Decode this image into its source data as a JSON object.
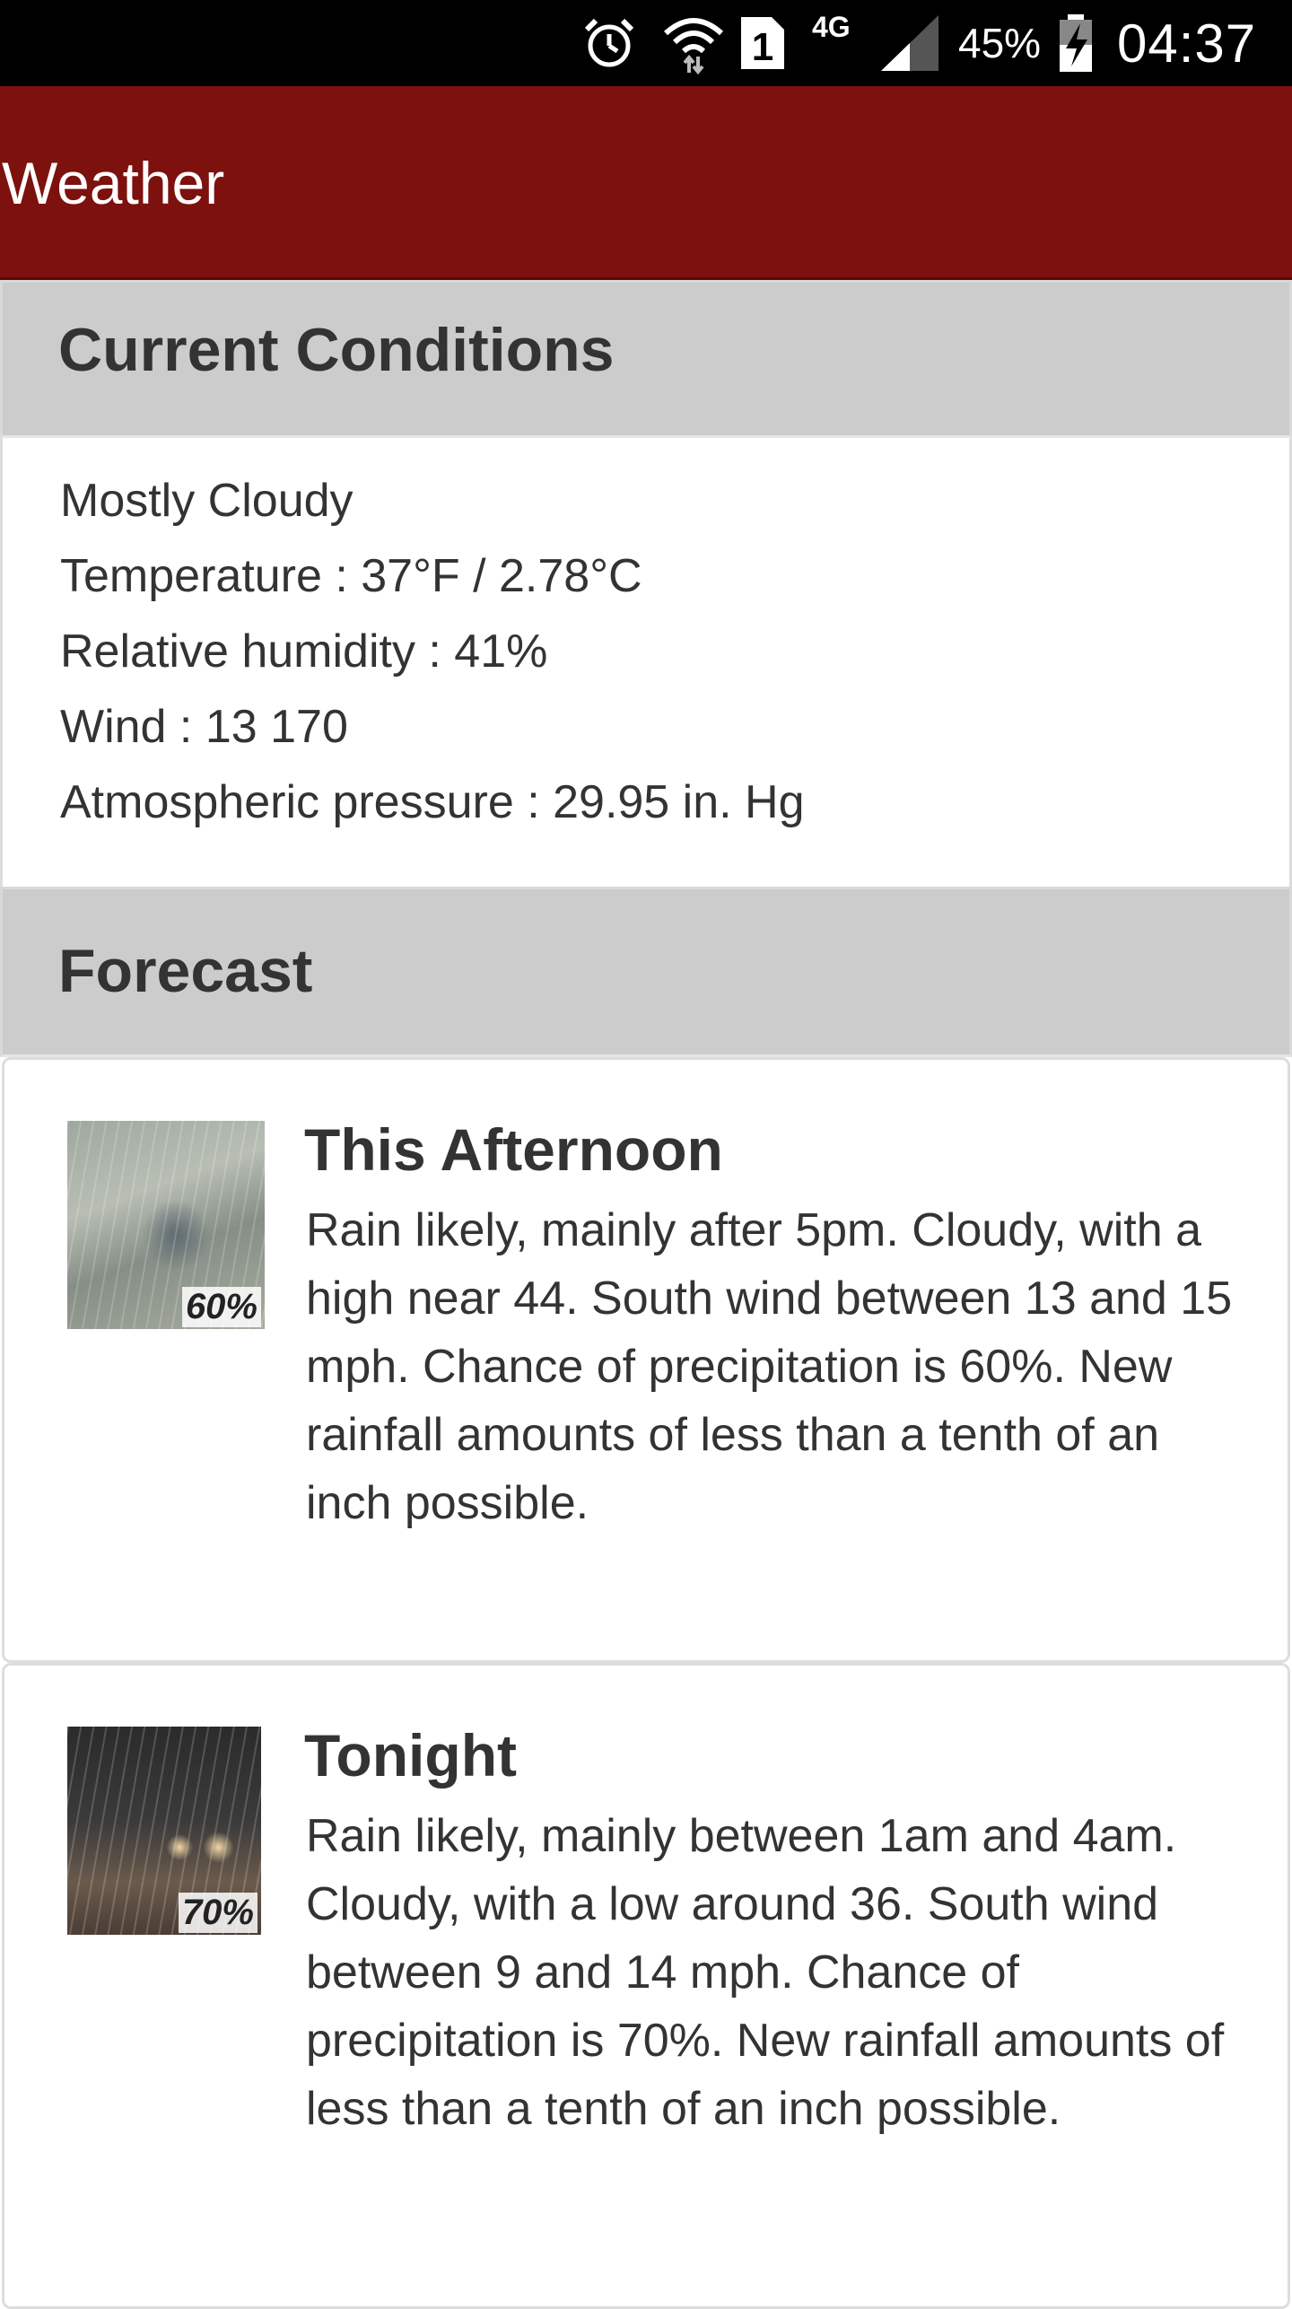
{
  "status_bar": {
    "network_type": "4G",
    "battery_percent": "45%",
    "time": "04:37",
    "sim_slot": "1",
    "icons": [
      "alarm-icon",
      "wifi-icon",
      "sim-icon",
      "signal-icon",
      "battery-charging-icon"
    ]
  },
  "app_bar": {
    "title": "Weather",
    "color": "#7d110e"
  },
  "current": {
    "header": "Current Conditions",
    "summary": "Mostly Cloudy",
    "temperature": "Temperature : 37°F / 2.78°C",
    "humidity": "Relative humidity : 41%",
    "wind": "Wind : 13 170",
    "pressure": "Atmospheric pressure : 29.95 in. Hg"
  },
  "forecast": {
    "header": "Forecast",
    "periods": [
      {
        "name": "This Afternoon",
        "icon_percent": "60%",
        "icon": "rain-afternoon-image",
        "text": "Rain likely, mainly after 5pm. Cloudy, with a high near 44. South wind between 13 and 15 mph. Chance of precipitation is 60%. New rainfall amounts of less than a tenth of an inch possible."
      },
      {
        "name": "Tonight",
        "icon_percent": "70%",
        "icon": "rain-night-image",
        "text": "Rain likely, mainly between 1am and 4am. Cloudy, with a low around 36. South wind between 9 and 14 mph. Chance of precipitation is 70%. New rainfall amounts of less than a tenth of an inch possible."
      }
    ]
  }
}
